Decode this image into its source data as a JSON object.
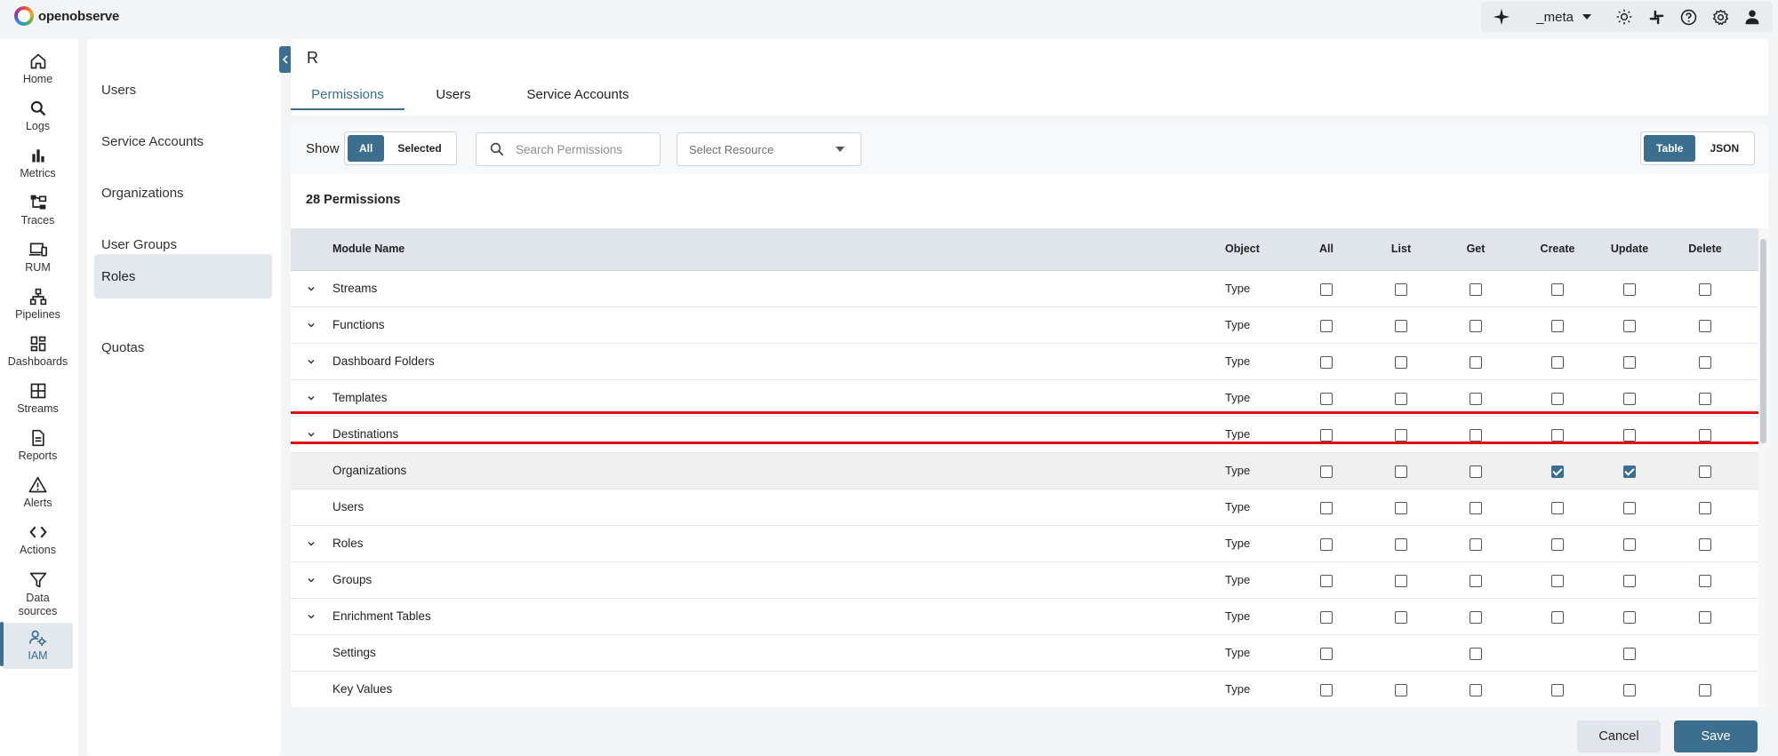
{
  "app": {
    "brand": "openobserve"
  },
  "topbar": {
    "org": "_meta"
  },
  "nav": [
    {
      "label": "Home",
      "icon": "home-icon"
    },
    {
      "label": "Logs",
      "icon": "search-icon"
    },
    {
      "label": "Metrics",
      "icon": "bar-chart-icon"
    },
    {
      "label": "Traces",
      "icon": "traces-icon"
    },
    {
      "label": "RUM",
      "icon": "devices-icon"
    },
    {
      "label": "Pipelines",
      "icon": "pipeline-icon"
    },
    {
      "label": "Dashboards",
      "icon": "dashboard-icon"
    },
    {
      "label": "Streams",
      "icon": "grid-icon"
    },
    {
      "label": "Reports",
      "icon": "document-icon"
    },
    {
      "label": "Alerts",
      "icon": "warning-icon"
    },
    {
      "label": "Actions",
      "icon": "code-icon"
    },
    {
      "label": "Data\nsources",
      "icon": "filter-icon"
    },
    {
      "label": "IAM",
      "icon": "iam-icon",
      "active": true
    }
  ],
  "submenu": [
    {
      "label": "Users"
    },
    {
      "label": "Service Accounts"
    },
    {
      "label": "Organizations"
    },
    {
      "label": "User Groups"
    },
    {
      "label": "Roles",
      "active": true
    },
    {
      "label": "Quotas"
    }
  ],
  "header": {
    "role_name": "R",
    "tabs": [
      {
        "label": "Permissions",
        "active": true
      },
      {
        "label": "Users"
      },
      {
        "label": "Service Accounts"
      }
    ]
  },
  "toolbar": {
    "show_label": "Show",
    "show_all": "All",
    "show_selected": "Selected",
    "search_placeholder": "Search Permissions",
    "resource_placeholder": "Select Resource",
    "view_table": "Table",
    "view_json": "JSON"
  },
  "permissions_count": "28 Permissions",
  "table": {
    "columns": [
      "Module Name",
      "Object",
      "All",
      "List",
      "Get",
      "Create",
      "Update",
      "Delete"
    ],
    "rows": [
      {
        "name": "Streams",
        "object": "Type",
        "expandable": true,
        "checks": [
          false,
          false,
          false,
          false,
          false,
          false
        ]
      },
      {
        "name": "Functions",
        "object": "Type",
        "expandable": true,
        "checks": [
          false,
          false,
          false,
          false,
          false,
          false
        ]
      },
      {
        "name": "Dashboard Folders",
        "object": "Type",
        "expandable": true,
        "checks": [
          false,
          false,
          false,
          false,
          false,
          false
        ]
      },
      {
        "name": "Templates",
        "object": "Type",
        "expandable": true,
        "checks": [
          false,
          false,
          false,
          false,
          false,
          false
        ]
      },
      {
        "name": "Destinations",
        "object": "Type",
        "expandable": true,
        "checks": [
          false,
          false,
          false,
          false,
          false,
          false
        ]
      },
      {
        "name": "Organizations",
        "object": "Type",
        "expandable": false,
        "selected": true,
        "checks": [
          false,
          false,
          false,
          true,
          true,
          false
        ]
      },
      {
        "name": "Users",
        "object": "Type",
        "expandable": false,
        "checks": [
          false,
          false,
          false,
          false,
          false,
          false
        ]
      },
      {
        "name": "Roles",
        "object": "Type",
        "expandable": true,
        "checks": [
          false,
          false,
          false,
          false,
          false,
          false
        ]
      },
      {
        "name": "Groups",
        "object": "Type",
        "expandable": true,
        "checks": [
          false,
          false,
          false,
          false,
          false,
          false
        ]
      },
      {
        "name": "Enrichment Tables",
        "object": "Type",
        "expandable": true,
        "checks": [
          false,
          false,
          false,
          false,
          false,
          false
        ]
      },
      {
        "name": "Settings",
        "object": "Type",
        "expandable": false,
        "checks": [
          false,
          null,
          false,
          null,
          false,
          null
        ]
      },
      {
        "name": "Key Values",
        "object": "Type",
        "expandable": false,
        "checks": [
          false,
          false,
          false,
          false,
          false,
          false
        ]
      }
    ]
  },
  "footer": {
    "cancel_label": "Cancel",
    "save_label": "Save"
  },
  "colors": {
    "accent": "#3c6e8f",
    "highlight": "#e01010"
  }
}
